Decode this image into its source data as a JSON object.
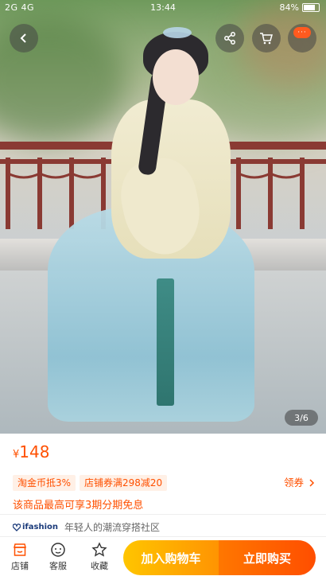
{
  "status_bar": {
    "network": "2G 4G",
    "time": "13:44",
    "battery": "84%"
  },
  "gallery": {
    "pager": "3/6"
  },
  "top_actions": {
    "more_badge": "···"
  },
  "product": {
    "currency": "¥",
    "price": "148",
    "promo_taojinbi": "淘金币抵3%",
    "promo_shop_coupon": "店铺券满298减20",
    "coupon_link": "领券",
    "installment": "该商品最高可享3期分期免息"
  },
  "shop": {
    "brand": "ifashion",
    "slogan": "年轻人的潮流穿搭社区"
  },
  "bottom_bar": {
    "tab_shop": "店铺",
    "tab_service": "客服",
    "tab_favorite": "收藏",
    "add_to_cart": "加入购物车",
    "buy_now": "立即购买"
  },
  "colors": {
    "accent": "#ff5000",
    "cart_button": "#ffa200",
    "buy_button": "#ff5a00"
  }
}
